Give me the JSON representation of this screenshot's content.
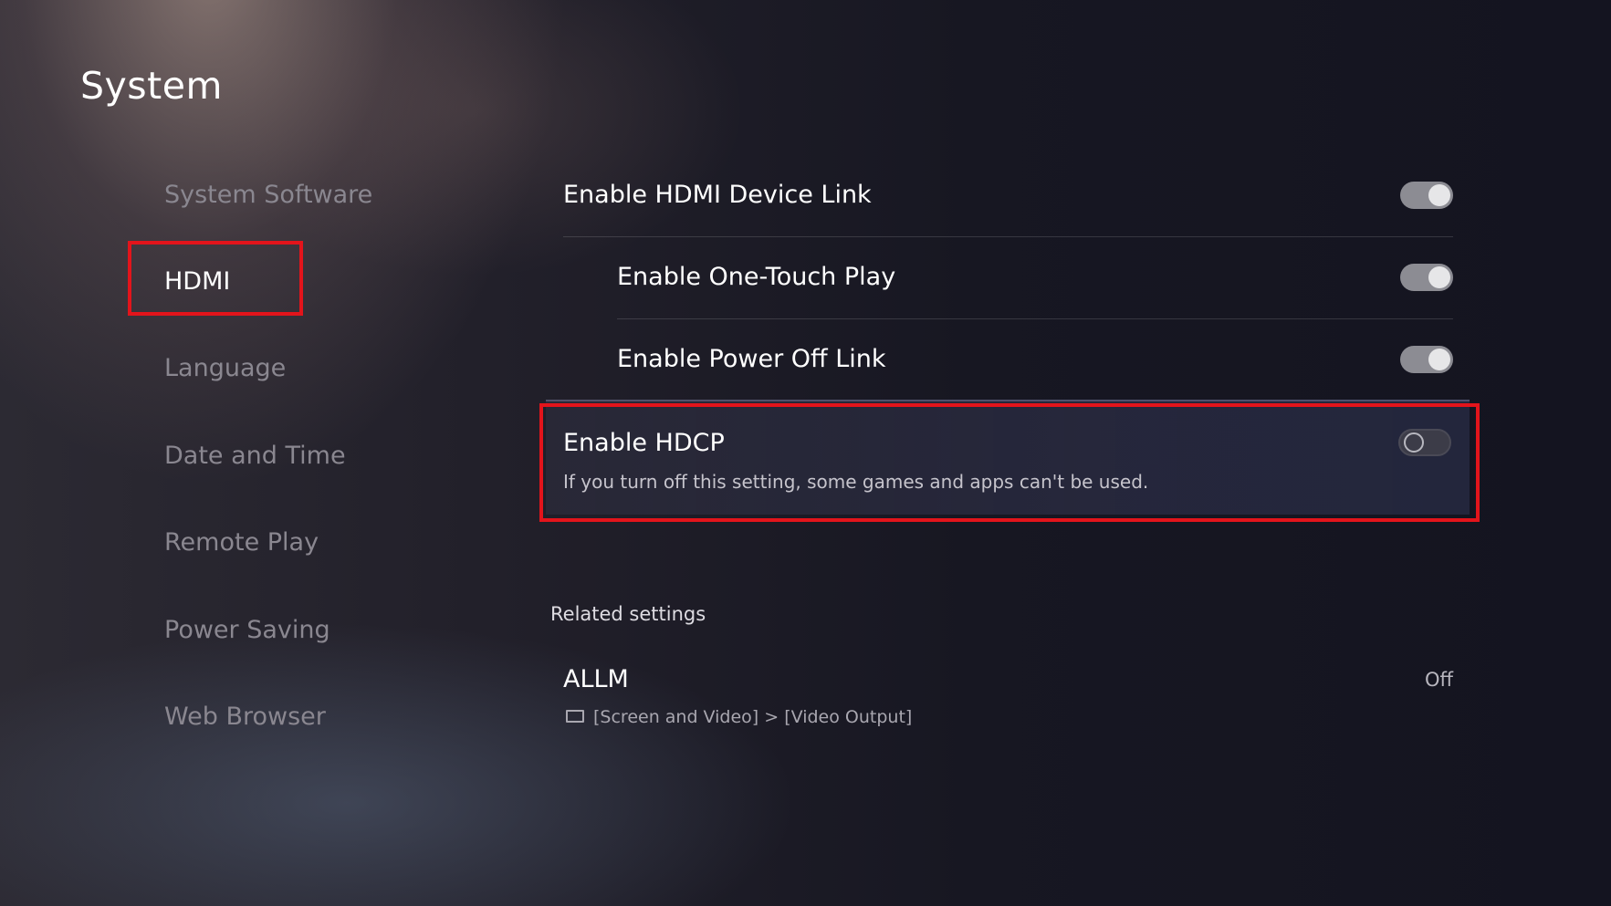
{
  "page": {
    "title": "System"
  },
  "sidebar": {
    "items": [
      {
        "label": "System Software",
        "active": false
      },
      {
        "label": "HDMI",
        "active": true
      },
      {
        "label": "Language",
        "active": false
      },
      {
        "label": "Date and Time",
        "active": false
      },
      {
        "label": "Remote Play",
        "active": false
      },
      {
        "label": "Power Saving",
        "active": false
      },
      {
        "label": "Web Browser",
        "active": false
      }
    ]
  },
  "settings": [
    {
      "label": "Enable HDMI Device Link",
      "state": "on"
    },
    {
      "label": "Enable One-Touch Play",
      "state": "on"
    },
    {
      "label": "Enable Power Off Link",
      "state": "on"
    },
    {
      "label": "Enable HDCP",
      "description": "If you turn off this setting, some games and apps can't be used.",
      "state": "off"
    }
  ],
  "related": {
    "title": "Related settings",
    "items": [
      {
        "label": "ALLM",
        "value": "Off",
        "path": "[Screen and Video] > [Video Output]",
        "icon": "screen-icon"
      }
    ]
  },
  "colors": {
    "annotation": "#e3141b",
    "toggle_on": "#8c8c93",
    "toggle_off": "#3c3c48",
    "inactive_text": "#8a8790"
  }
}
